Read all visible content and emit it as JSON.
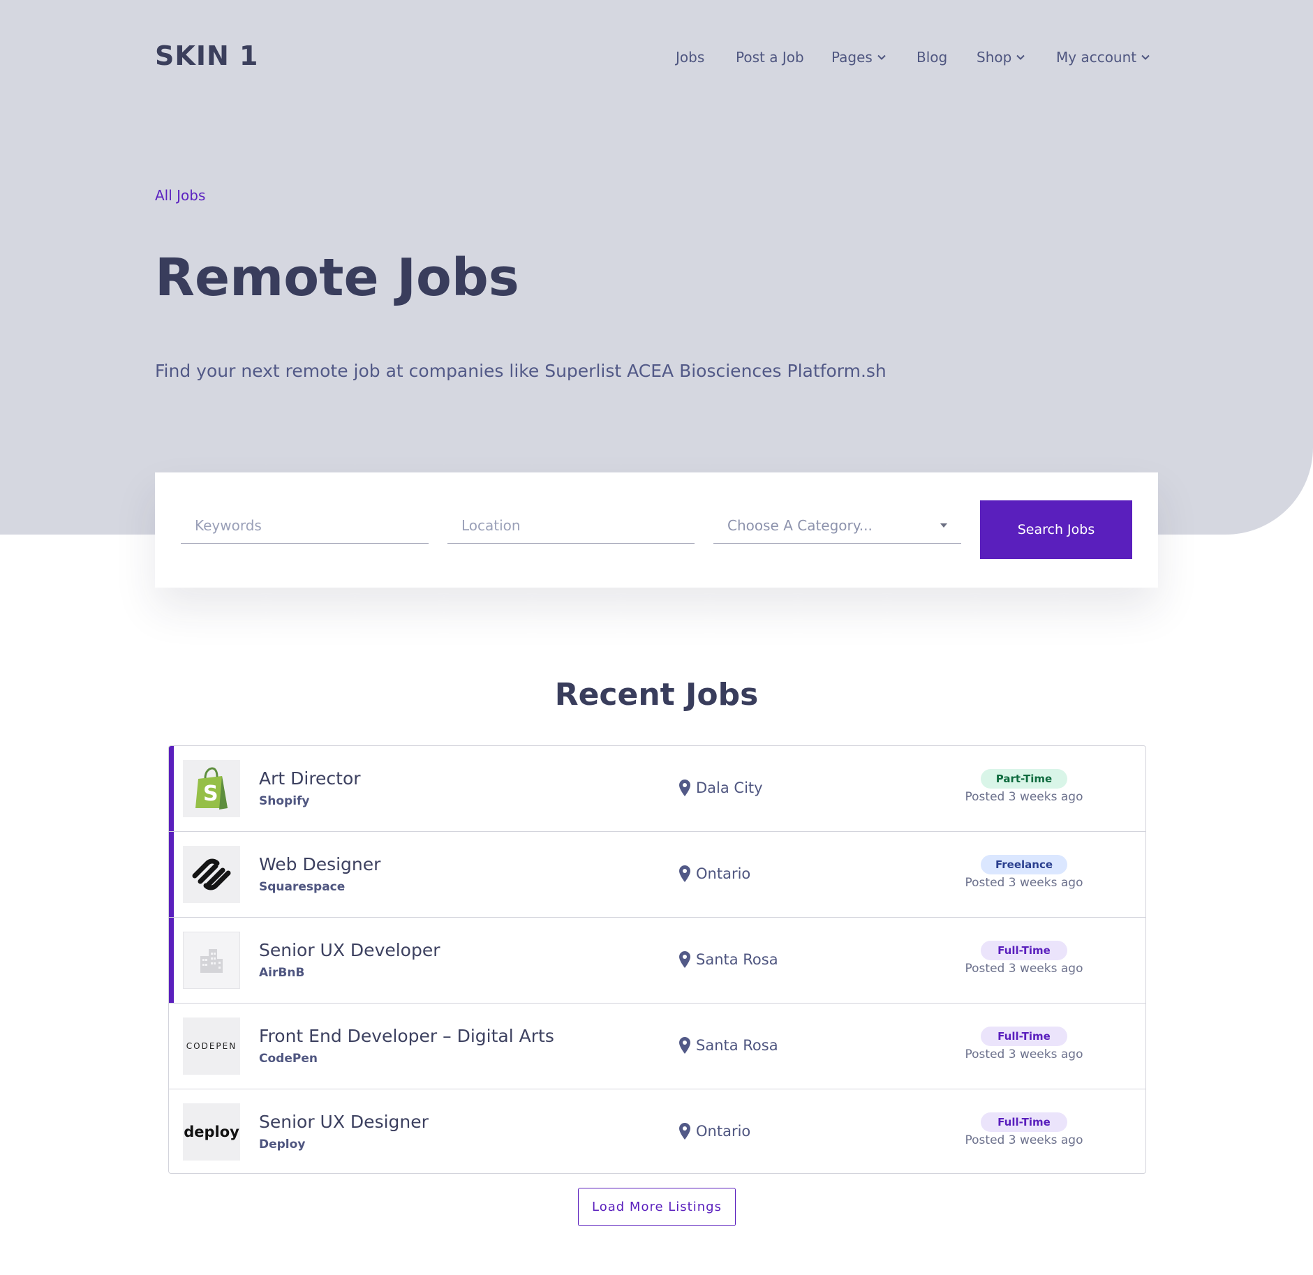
{
  "brand": {
    "logo_text": "SKIN 1"
  },
  "nav": {
    "items": [
      {
        "label": "Jobs",
        "has_dropdown": false
      },
      {
        "label": "Post a Job",
        "has_dropdown": false
      },
      {
        "label": "Pages",
        "has_dropdown": true
      },
      {
        "label": "Blog",
        "has_dropdown": false
      },
      {
        "label": "Shop",
        "has_dropdown": true
      },
      {
        "label": "My account",
        "has_dropdown": true
      }
    ]
  },
  "hero": {
    "breadcrumb": "All Jobs",
    "title": "Remote Jobs",
    "subtitle": "Find your next remote job at companies like Superlist ACEA Biosciences Platform.sh"
  },
  "search": {
    "keywords_placeholder": "Keywords",
    "location_placeholder": "Location",
    "category_placeholder": "Choose A Category...",
    "button_label": "Search Jobs"
  },
  "recent": {
    "title": "Recent Jobs",
    "jobs": [
      {
        "title": "Art Director",
        "company": "Shopify",
        "location": "Dala City",
        "type": "Part-Time",
        "posted": "Posted 3 weeks ago",
        "featured": true,
        "logo": "shopify-logo"
      },
      {
        "title": "Web Designer",
        "company": "Squarespace",
        "location": "Ontario",
        "type": "Freelance",
        "posted": "Posted 3 weeks ago",
        "featured": true,
        "logo": "squarespace-logo"
      },
      {
        "title": "Senior UX Developer",
        "company": "AirBnB",
        "location": "Santa Rosa",
        "type": "Full-Time",
        "posted": "Posted 3 weeks ago",
        "featured": true,
        "logo": "company-placeholder-icon"
      },
      {
        "title": "Front End Developer – Digital Arts",
        "company": "CodePen",
        "location": "Santa Rosa",
        "type": "Full-Time",
        "posted": "Posted 3 weeks ago",
        "featured": false,
        "logo": "codepen-logo"
      },
      {
        "title": "Senior UX Designer",
        "company": "Deploy",
        "location": "Ontario",
        "type": "Full-Time",
        "posted": "Posted 3 weeks ago",
        "featured": false,
        "logo": "deploy-logo"
      }
    ],
    "badge_colors": {
      "Part-Time": {
        "bg": "#d9f5e8",
        "fg": "#0f6b3f"
      },
      "Freelance": {
        "bg": "#dbe7ff",
        "fg": "#2a3f8f"
      },
      "Full-Time": {
        "bg": "#ebe4fb",
        "fg": "#5a1fbd"
      }
    },
    "load_more_label": "Load More Listings",
    "logo_text": {
      "codepen": "CODEPEN",
      "deploy": "deploy"
    }
  },
  "colors": {
    "accent": "#5a1fbd",
    "hero_bg": "#d5d7e0",
    "heading": "#393d5c",
    "nav_text": "#4f5680"
  }
}
